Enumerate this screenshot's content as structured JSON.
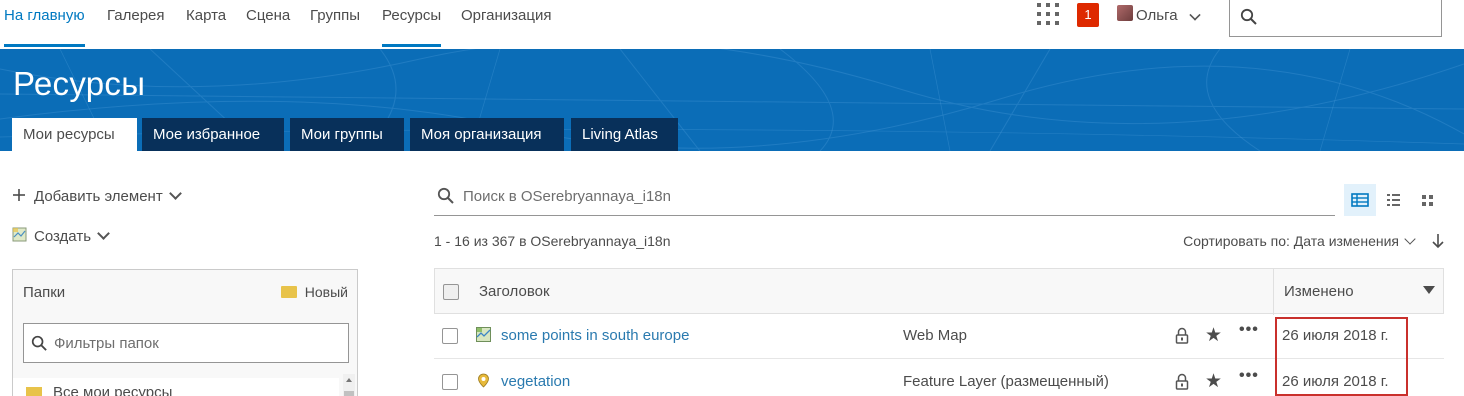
{
  "nav": {
    "items": [
      {
        "label": "На главную"
      },
      {
        "label": "Галерея"
      },
      {
        "label": "Карта"
      },
      {
        "label": "Сцена"
      },
      {
        "label": "Группы"
      },
      {
        "label": "Ресурсы"
      },
      {
        "label": "Организация"
      }
    ],
    "active_index": 0,
    "selected_index": 5,
    "notifications_count": "1",
    "user_name": "Ольга",
    "search_placeholder": ""
  },
  "banner": {
    "title": "Ресурсы",
    "tabs": [
      {
        "label": "Мои ресурсы"
      },
      {
        "label": "Мое избранное"
      },
      {
        "label": "Мои группы"
      },
      {
        "label": "Моя организация"
      },
      {
        "label": "Living Atlas"
      }
    ],
    "active_tab": 0
  },
  "sidebar": {
    "add_item_label": "Добавить элемент",
    "create_label": "Создать",
    "folders": {
      "header": "Папки",
      "new_label": "Новый",
      "filter_placeholder": "Фильтры папок",
      "items": [
        {
          "label": "Все мои ресурсы"
        }
      ]
    }
  },
  "main": {
    "search_placeholder": "Поиск в OSerebryannaya_i18n",
    "view_modes": [
      "table-view-icon",
      "list-view-icon",
      "grid-view-icon"
    ],
    "active_view": "table",
    "count_text": "1 - 16 из 367 в OSerebryannaya_i18n",
    "sort_text": "Сортировать по: Дата изменения",
    "table": {
      "col_title": "Заголовок",
      "col_modified": "Изменено",
      "rows": [
        {
          "title": "some points in south europe",
          "type": "Web Map",
          "icon": "web-map-icon",
          "modified": "26 июля 2018 г.",
          "more": "•••"
        },
        {
          "title": "vegetation",
          "type": "Feature Layer (размещенный)",
          "icon": "feature-layer-icon",
          "modified": "26 июля 2018 г.",
          "more": "•••"
        }
      ]
    }
  },
  "colors": {
    "accent": "#0079c1",
    "banner": "#0b6db7",
    "tab_dark": "#08305a",
    "notification": "#de2900",
    "link": "#2a7aaf",
    "highlight_box": "#c9302c"
  }
}
